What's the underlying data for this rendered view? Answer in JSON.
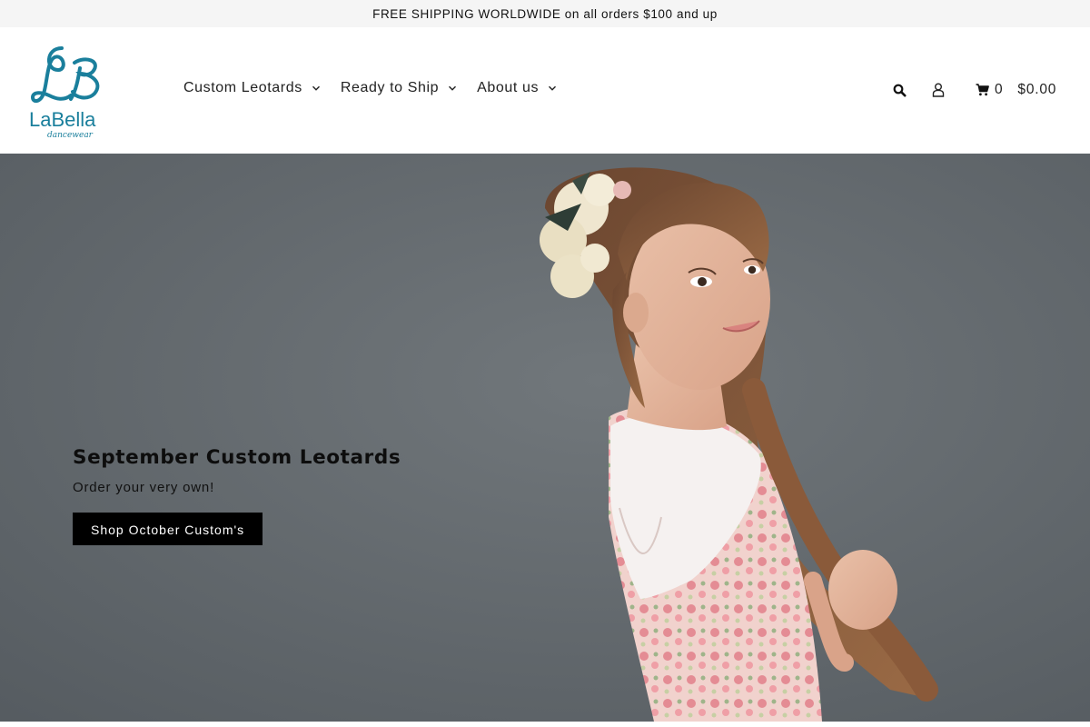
{
  "announcement": {
    "text": "FREE SHIPPING WORLDWIDE on all orders $100 and up"
  },
  "brand": {
    "name": "LaBella",
    "tagline": "dancewear",
    "monogram": "LB",
    "color": "#1a7f9c"
  },
  "nav": {
    "items": [
      {
        "label": "Custom Leotards"
      },
      {
        "label": "Ready to Ship"
      },
      {
        "label": "About us"
      }
    ]
  },
  "header_tools": {
    "search_icon": "search-icon",
    "account_icon": "user-icon",
    "cart_icon": "shopping-cart-icon",
    "cart_count": "0",
    "cart_total": "$0.00"
  },
  "hero": {
    "title": "September Custom Leotards",
    "subtitle": "Order your very own!",
    "button_label": "Shop October Custom's",
    "background_color": "#62686d"
  }
}
